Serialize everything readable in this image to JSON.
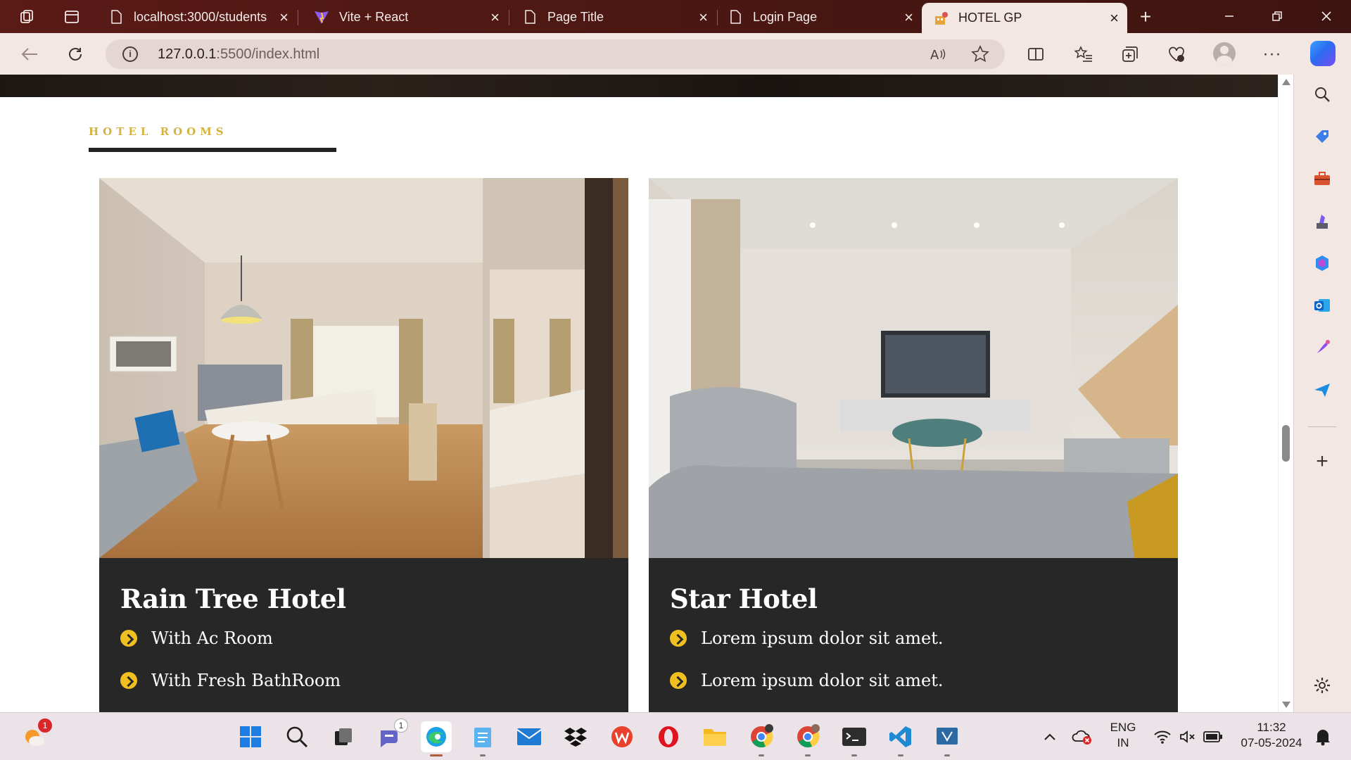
{
  "browser": {
    "tabs": [
      {
        "title": "localhost:3000/students",
        "favicon": "page-icon"
      },
      {
        "title": "Vite + React",
        "favicon": "vite-icon"
      },
      {
        "title": "Page Title",
        "favicon": "page-icon"
      },
      {
        "title": "Login Page",
        "favicon": "page-icon"
      },
      {
        "title": "HOTEL GP",
        "favicon": "hotel-icon",
        "active": true
      }
    ],
    "url_host": "127.0.0.1",
    "url_rest": ":5500/index.html"
  },
  "page": {
    "section_label": "HOTEL ROOMS",
    "rooms": [
      {
        "title": "Rain Tree Hotel",
        "features": [
          "With Ac Room",
          "With Fresh BathRoom"
        ]
      },
      {
        "title": "Star Hotel",
        "features": [
          "Lorem ipsum dolor sit amet.",
          "Lorem ipsum dolor sit amet."
        ]
      }
    ]
  },
  "taskbar": {
    "language": "ENG",
    "region": "IN",
    "time": "11:32",
    "date": "07-05-2024",
    "badges": {
      "weather": "1",
      "teams": "1"
    }
  },
  "colors": {
    "accent_gold": "#d6b23f",
    "card_bg": "#272727",
    "tabbar_bg": "#4a1712"
  }
}
